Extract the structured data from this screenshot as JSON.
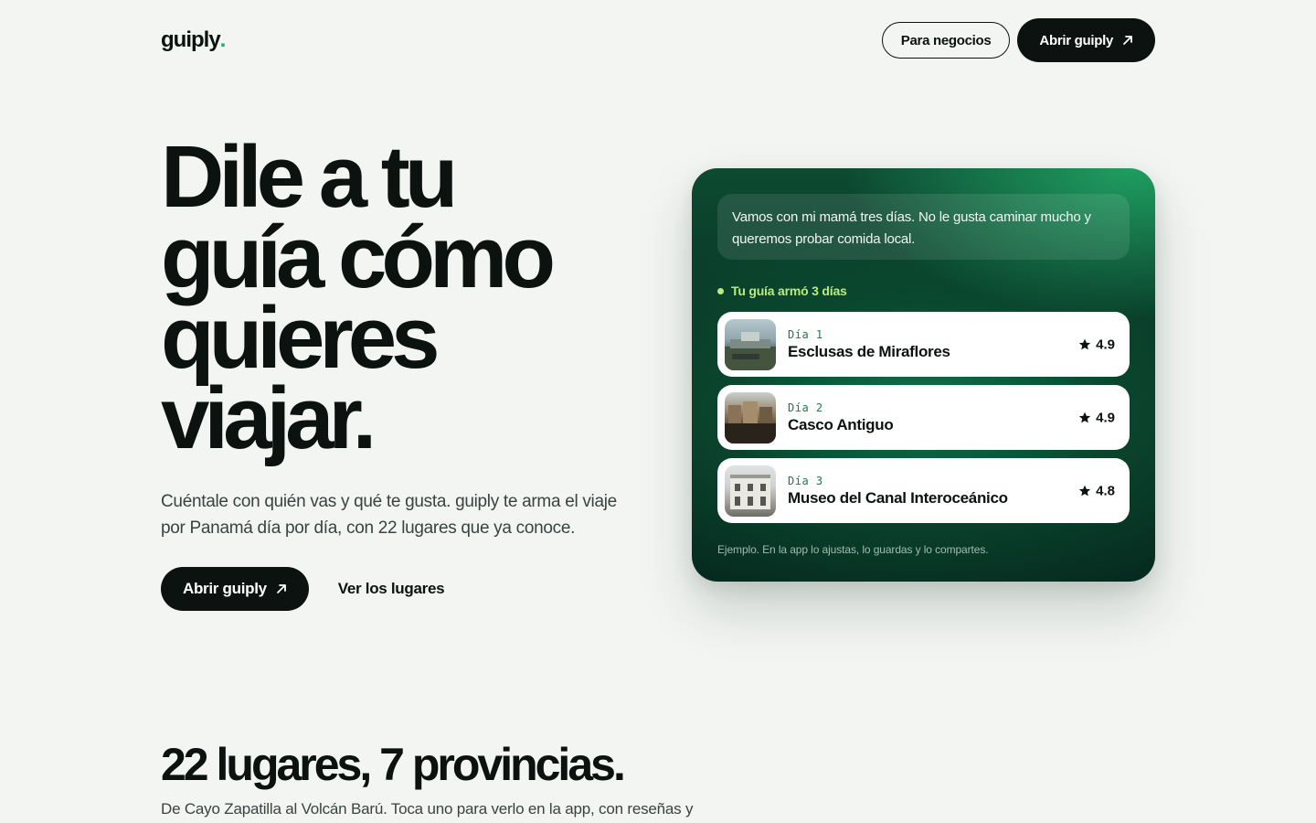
{
  "header": {
    "logo_text": "guiply",
    "logo_dot": ".",
    "business_button": "Para negocios",
    "open_button": "Abrir guiply"
  },
  "hero": {
    "title_lines": [
      "Dile a tu",
      "guía cómo",
      "quieres",
      "viajar."
    ],
    "subtitle": "Cuéntale con quién vas y qué te gusta. guiply te arma el viaje por Panamá día por día, con 22 lugares que ya conoce.",
    "primary_button": "Abrir guiply",
    "secondary_link": "Ver los lugares"
  },
  "card": {
    "prompt": "Vamos con mi mamá tres días. No le gusta caminar mucho y queremos probar comida local.",
    "status": "Tu guía armó 3 días",
    "days": [
      {
        "label": "Día 1",
        "name": "Esclusas de Miraflores",
        "rating": "4.9"
      },
      {
        "label": "Día 2",
        "name": "Casco Antiguo",
        "rating": "4.9"
      },
      {
        "label": "Día 3",
        "name": "Museo del Canal Interoceánico",
        "rating": "4.8"
      }
    ],
    "footnote": "Ejemplo. En la app lo ajustas, lo guardas y lo compartes.",
    "accent_color": "#b9ec7a"
  },
  "section2": {
    "title": "22 lugares, 7 provincias.",
    "subtitle": "De Cayo Zapatilla al Volcán Barú. Toca uno para verlo en la app, con reseñas y"
  },
  "colors": {
    "background": "#f3f5f2",
    "text": "#0b1210",
    "brand_green": "#20b06a",
    "card_dark": "#073222"
  },
  "icons": {
    "arrow": "arrow-up-right-icon",
    "star": "star-icon"
  }
}
